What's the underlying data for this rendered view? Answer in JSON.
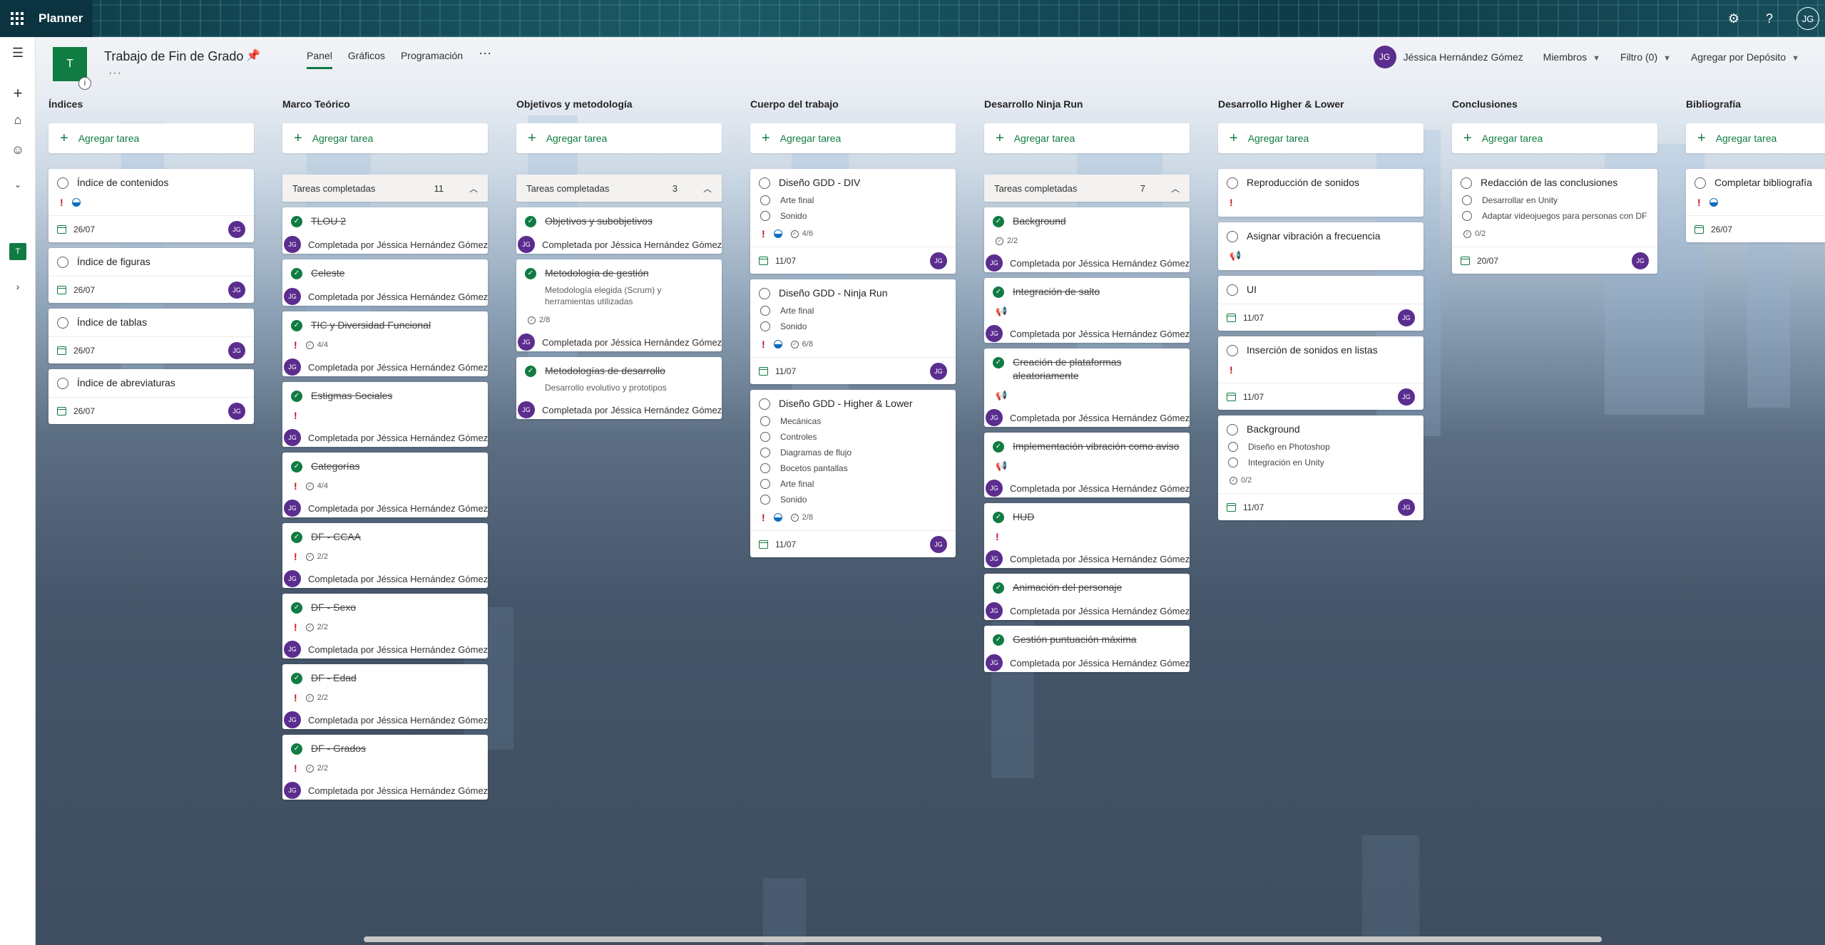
{
  "app": {
    "name": "Planner",
    "user_initials": "JG"
  },
  "plan": {
    "logo_letter": "T",
    "title": "Trabajo de Fin de Grado",
    "more": "···",
    "info": "i",
    "rail_letter": "T"
  },
  "tabs": [
    "Panel",
    "Gráficos",
    "Programación"
  ],
  "tab_more": "···",
  "header": {
    "user_name": "Jéssica Hernández Gómez",
    "members": "Miembros",
    "filter": "Filtro (0)",
    "group_by": "Agregar por Depósito"
  },
  "add_task_label": "Agregar tarea",
  "completed_label": "Tareas completadas",
  "completed_by_label": "Completada por Jéssica Hernández Gómez e",
  "columns": [
    {
      "name": "Índices",
      "tasks": [
        {
          "title": "Índice de contenidos",
          "priority": "!",
          "progress": "half",
          "date": "26/07",
          "assignee": "JG"
        },
        {
          "title": "Índice de figuras",
          "date": "26/07",
          "assignee": "JG"
        },
        {
          "title": "Índice de tablas",
          "date": "26/07",
          "assignee": "JG"
        },
        {
          "title": "Índice de abreviaturas",
          "date": "26/07",
          "assignee": "JG"
        }
      ]
    },
    {
      "name": "Marco Teórico",
      "completed_count": "11",
      "completed": [
        {
          "title": "TLOU 2"
        },
        {
          "title": "Celeste"
        },
        {
          "title": "TIC y Diversidad Funcional",
          "priority": "!",
          "checklist": "4/4"
        },
        {
          "title": "Estigmas Sociales",
          "priority": "!"
        },
        {
          "title": "Categorías",
          "priority": "!",
          "checklist": "4/4"
        },
        {
          "title": "DF - CCAA",
          "priority": "!",
          "checklist": "2/2"
        },
        {
          "title": "DF - Sexo",
          "priority": "!",
          "checklist": "2/2"
        },
        {
          "title": "DF - Edad",
          "priority": "!",
          "checklist": "2/2"
        },
        {
          "title": "DF - Grados",
          "priority": "!",
          "checklist": "2/2"
        }
      ]
    },
    {
      "name": "Objetivos y metodología",
      "completed_count": "3",
      "completed": [
        {
          "title": "Objetivos y subobjetivos"
        },
        {
          "title": "Metodología de gestión",
          "desc": "Metodología elegida (Scrum) y herramientas utilizadas",
          "checklist": "2/8"
        },
        {
          "title": "Metodologías de desarrollo",
          "desc": "Desarrollo evolutivo y prototipos"
        }
      ]
    },
    {
      "name": "Cuerpo del trabajo",
      "tasks": [
        {
          "title": "Diseño GDD - DIV",
          "items": [
            "Arte final",
            "Sonido"
          ],
          "priority": "!",
          "progress": "half",
          "checklist": "4/6",
          "date": "11/07",
          "assignee": "JG"
        },
        {
          "title": "Diseño GDD - Ninja Run",
          "items": [
            "Arte final",
            "Sonido"
          ],
          "priority": "!",
          "progress": "half",
          "checklist": "6/8",
          "date": "11/07",
          "assignee": "JG"
        },
        {
          "title": "Diseño GDD - Higher & Lower",
          "items": [
            "Mecánicas",
            "Controles",
            "Diagramas de flujo",
            "Bocetos pantallas",
            "Arte final",
            "Sonido"
          ],
          "priority": "!",
          "progress": "half",
          "checklist": "2/8",
          "date": "11/07",
          "assignee": "JG"
        }
      ]
    },
    {
      "name": "Desarrollo Ninja Run",
      "completed_count": "7",
      "completed": [
        {
          "title": "Background",
          "checklist": "2/2"
        },
        {
          "title": "Integración de salto",
          "bell": true
        },
        {
          "title": "Creación de plataformas aleatoriamente",
          "bell": true
        },
        {
          "title": "Implementación vibración como aviso",
          "bell": true
        },
        {
          "title": "HUD",
          "priority": "!"
        },
        {
          "title": "Animación del personaje"
        },
        {
          "title": "Gestión puntuación máxima"
        }
      ]
    },
    {
      "name": "Desarrollo Higher & Lower",
      "tasks": [
        {
          "title": "Reproducción de sonidos",
          "priority": "!"
        },
        {
          "title": "Asignar vibración a frecuencia",
          "bell": true
        },
        {
          "title": "UI",
          "date": "11/07",
          "assignee": "JG"
        },
        {
          "title": "Inserción de sonidos en listas",
          "priority": "!",
          "date": "11/07",
          "assignee": "JG"
        },
        {
          "title": "Background",
          "items": [
            "Diseño en Photoshop",
            "Integración en Unity"
          ],
          "checklist": "0/2",
          "date": "11/07",
          "assignee": "JG"
        }
      ]
    },
    {
      "name": "Conclusiones",
      "tasks": [
        {
          "title": "Redacción de las conclusiones",
          "items": [
            "Desarrollar en Unity",
            "Adaptar videojuegos para personas con DF"
          ],
          "checklist": "0/2",
          "date": "20/07",
          "assignee": "JG"
        }
      ]
    },
    {
      "name": "Bibliografía",
      "tasks": [
        {
          "title": "Completar bibliografía",
          "priority": "!",
          "progress": "half",
          "date": "26/07"
        }
      ]
    }
  ]
}
